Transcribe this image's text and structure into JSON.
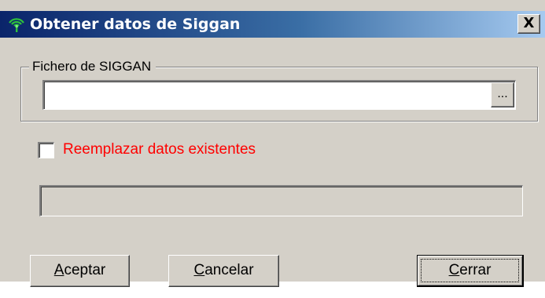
{
  "window": {
    "title": "Obtener datos de Siggan",
    "app_icon": "antenna-icon",
    "close_label": "X",
    "colors": {
      "titlebar_start": "#0a246a",
      "titlebar_end": "#a6caf0",
      "face": "#d4d0c8",
      "warning_text": "#ff0000"
    }
  },
  "file_group": {
    "legend": "Fichero de SIGGAN",
    "file_value": "",
    "browse_label": "..."
  },
  "options": {
    "replace_label": "Reemplazar datos existentes",
    "replace_checked": false
  },
  "progress": {
    "value_percent": 0
  },
  "buttons": {
    "accept": {
      "accel": "A",
      "rest": "ceptar"
    },
    "cancel": {
      "accel": "C",
      "rest": "ancelar"
    },
    "close": {
      "accel": "C",
      "rest": "errar"
    }
  }
}
